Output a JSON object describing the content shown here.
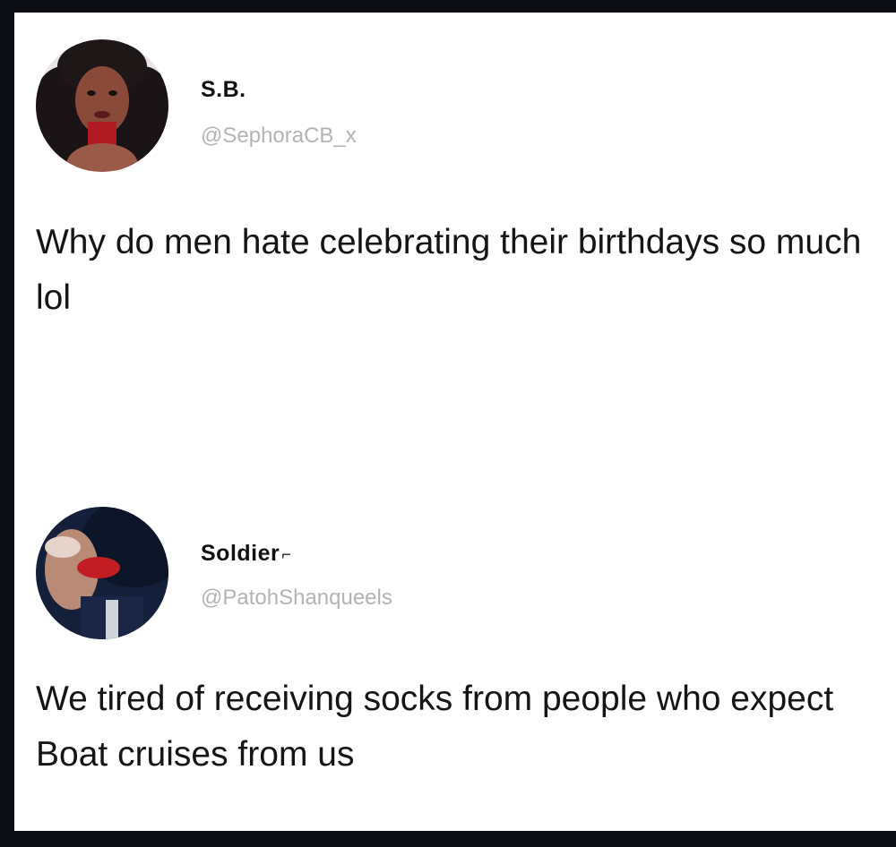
{
  "tweets": [
    {
      "display_name": "S.B.",
      "name_mark": "",
      "handle": "@SephoraCB_x",
      "text": "Why do men hate celebrating their birthdays so much lol",
      "avatar_icon": "profile-photo-icon"
    },
    {
      "display_name": "Soldier",
      "name_mark": "⌐",
      "handle": "@PatohShanqueels",
      "text": "We tired of receiving socks from people who expect Boat cruises from us",
      "avatar_icon": "profile-photo-icon"
    }
  ],
  "colors": {
    "background": "#0b0d12",
    "card": "#ffffff",
    "name": "#111111",
    "handle": "#b3b3b3",
    "text": "#151515"
  }
}
